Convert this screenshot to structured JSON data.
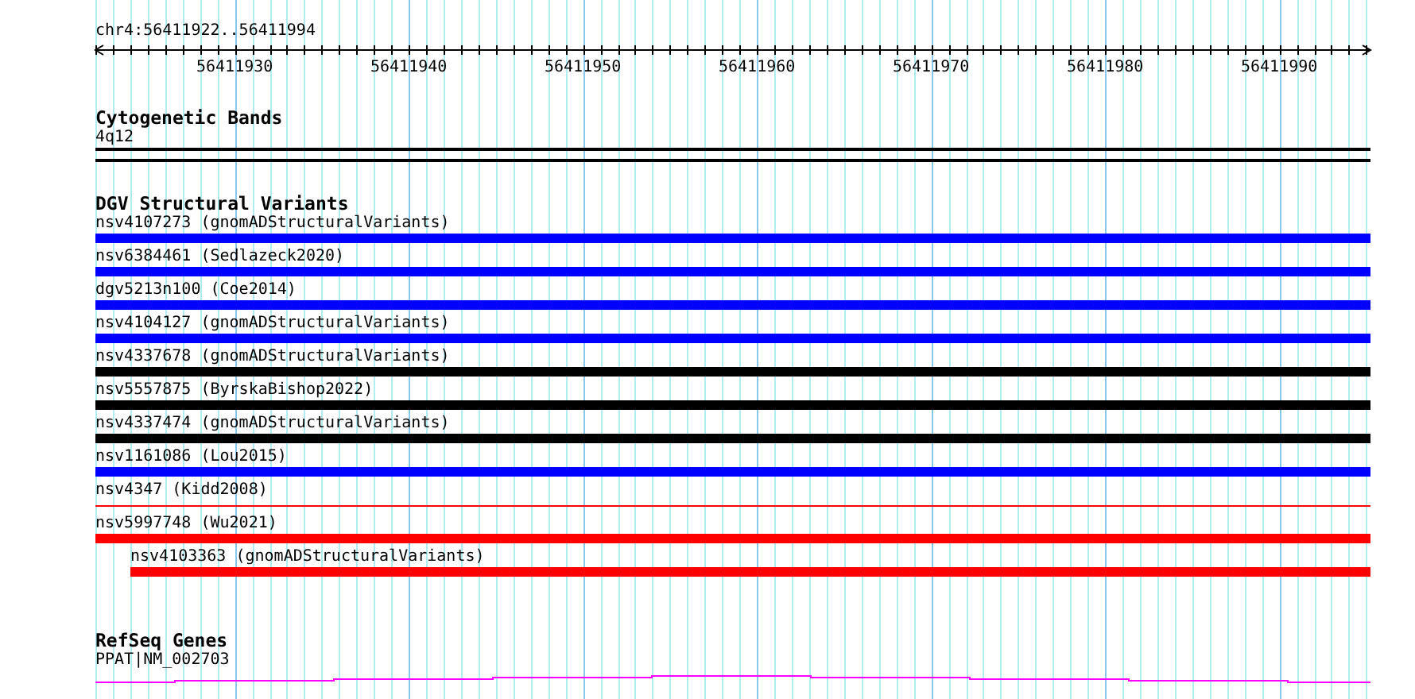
{
  "ruler": {
    "location": "chr4:56411922..56411994",
    "tick_labels": [
      "56411930",
      "56411940",
      "56411950",
      "56411960",
      "56411970",
      "56411980",
      "56411990"
    ]
  },
  "tracks": [
    {
      "kind": "bands",
      "title": "Cytogenetic Bands",
      "features": [
        {
          "label": "4q12"
        }
      ]
    },
    {
      "kind": "variants",
      "title": "DGV Structural Variants",
      "features": [
        {
          "label": "nsv4107273 (gnomADStructuralVariants)",
          "kind": "bar",
          "color": "#0000ff",
          "indented": false
        },
        {
          "label": "nsv6384461 (Sedlazeck2020)",
          "kind": "bar",
          "color": "#0000ff",
          "indented": false
        },
        {
          "label": "dgv5213n100 (Coe2014)",
          "kind": "bar",
          "color": "#0000ff",
          "indented": false
        },
        {
          "label": "nsv4104127 (gnomADStructuralVariants)",
          "kind": "bar",
          "color": "#0000ff",
          "indented": false
        },
        {
          "label": "nsv4337678 (gnomADStructuralVariants)",
          "kind": "bar",
          "color": "#000000",
          "indented": false
        },
        {
          "label": "nsv5557875 (ByrskaBishop2022)",
          "kind": "bar",
          "color": "#000000",
          "indented": false
        },
        {
          "label": "nsv4337474 (gnomADStructuralVariants)",
          "kind": "bar",
          "color": "#000000",
          "indented": false
        },
        {
          "label": "nsv1161086 (Lou2015)",
          "kind": "bar",
          "color": "#0000ff",
          "indented": false
        },
        {
          "label": "nsv4347 (Kidd2008)",
          "kind": "line",
          "color": "#ff0000",
          "indented": false
        },
        {
          "label": "nsv5997748 (Wu2021)",
          "kind": "bar",
          "color": "#ff0000",
          "indented": false
        },
        {
          "label": "nsv4103363 (gnomADStructuralVariants)",
          "kind": "bar",
          "color": "#ff0000",
          "indented": true
        }
      ]
    },
    {
      "kind": "genes",
      "title": "RefSeq Genes",
      "features": [
        {
          "label": "PPAT|NM_002703"
        }
      ]
    }
  ]
}
